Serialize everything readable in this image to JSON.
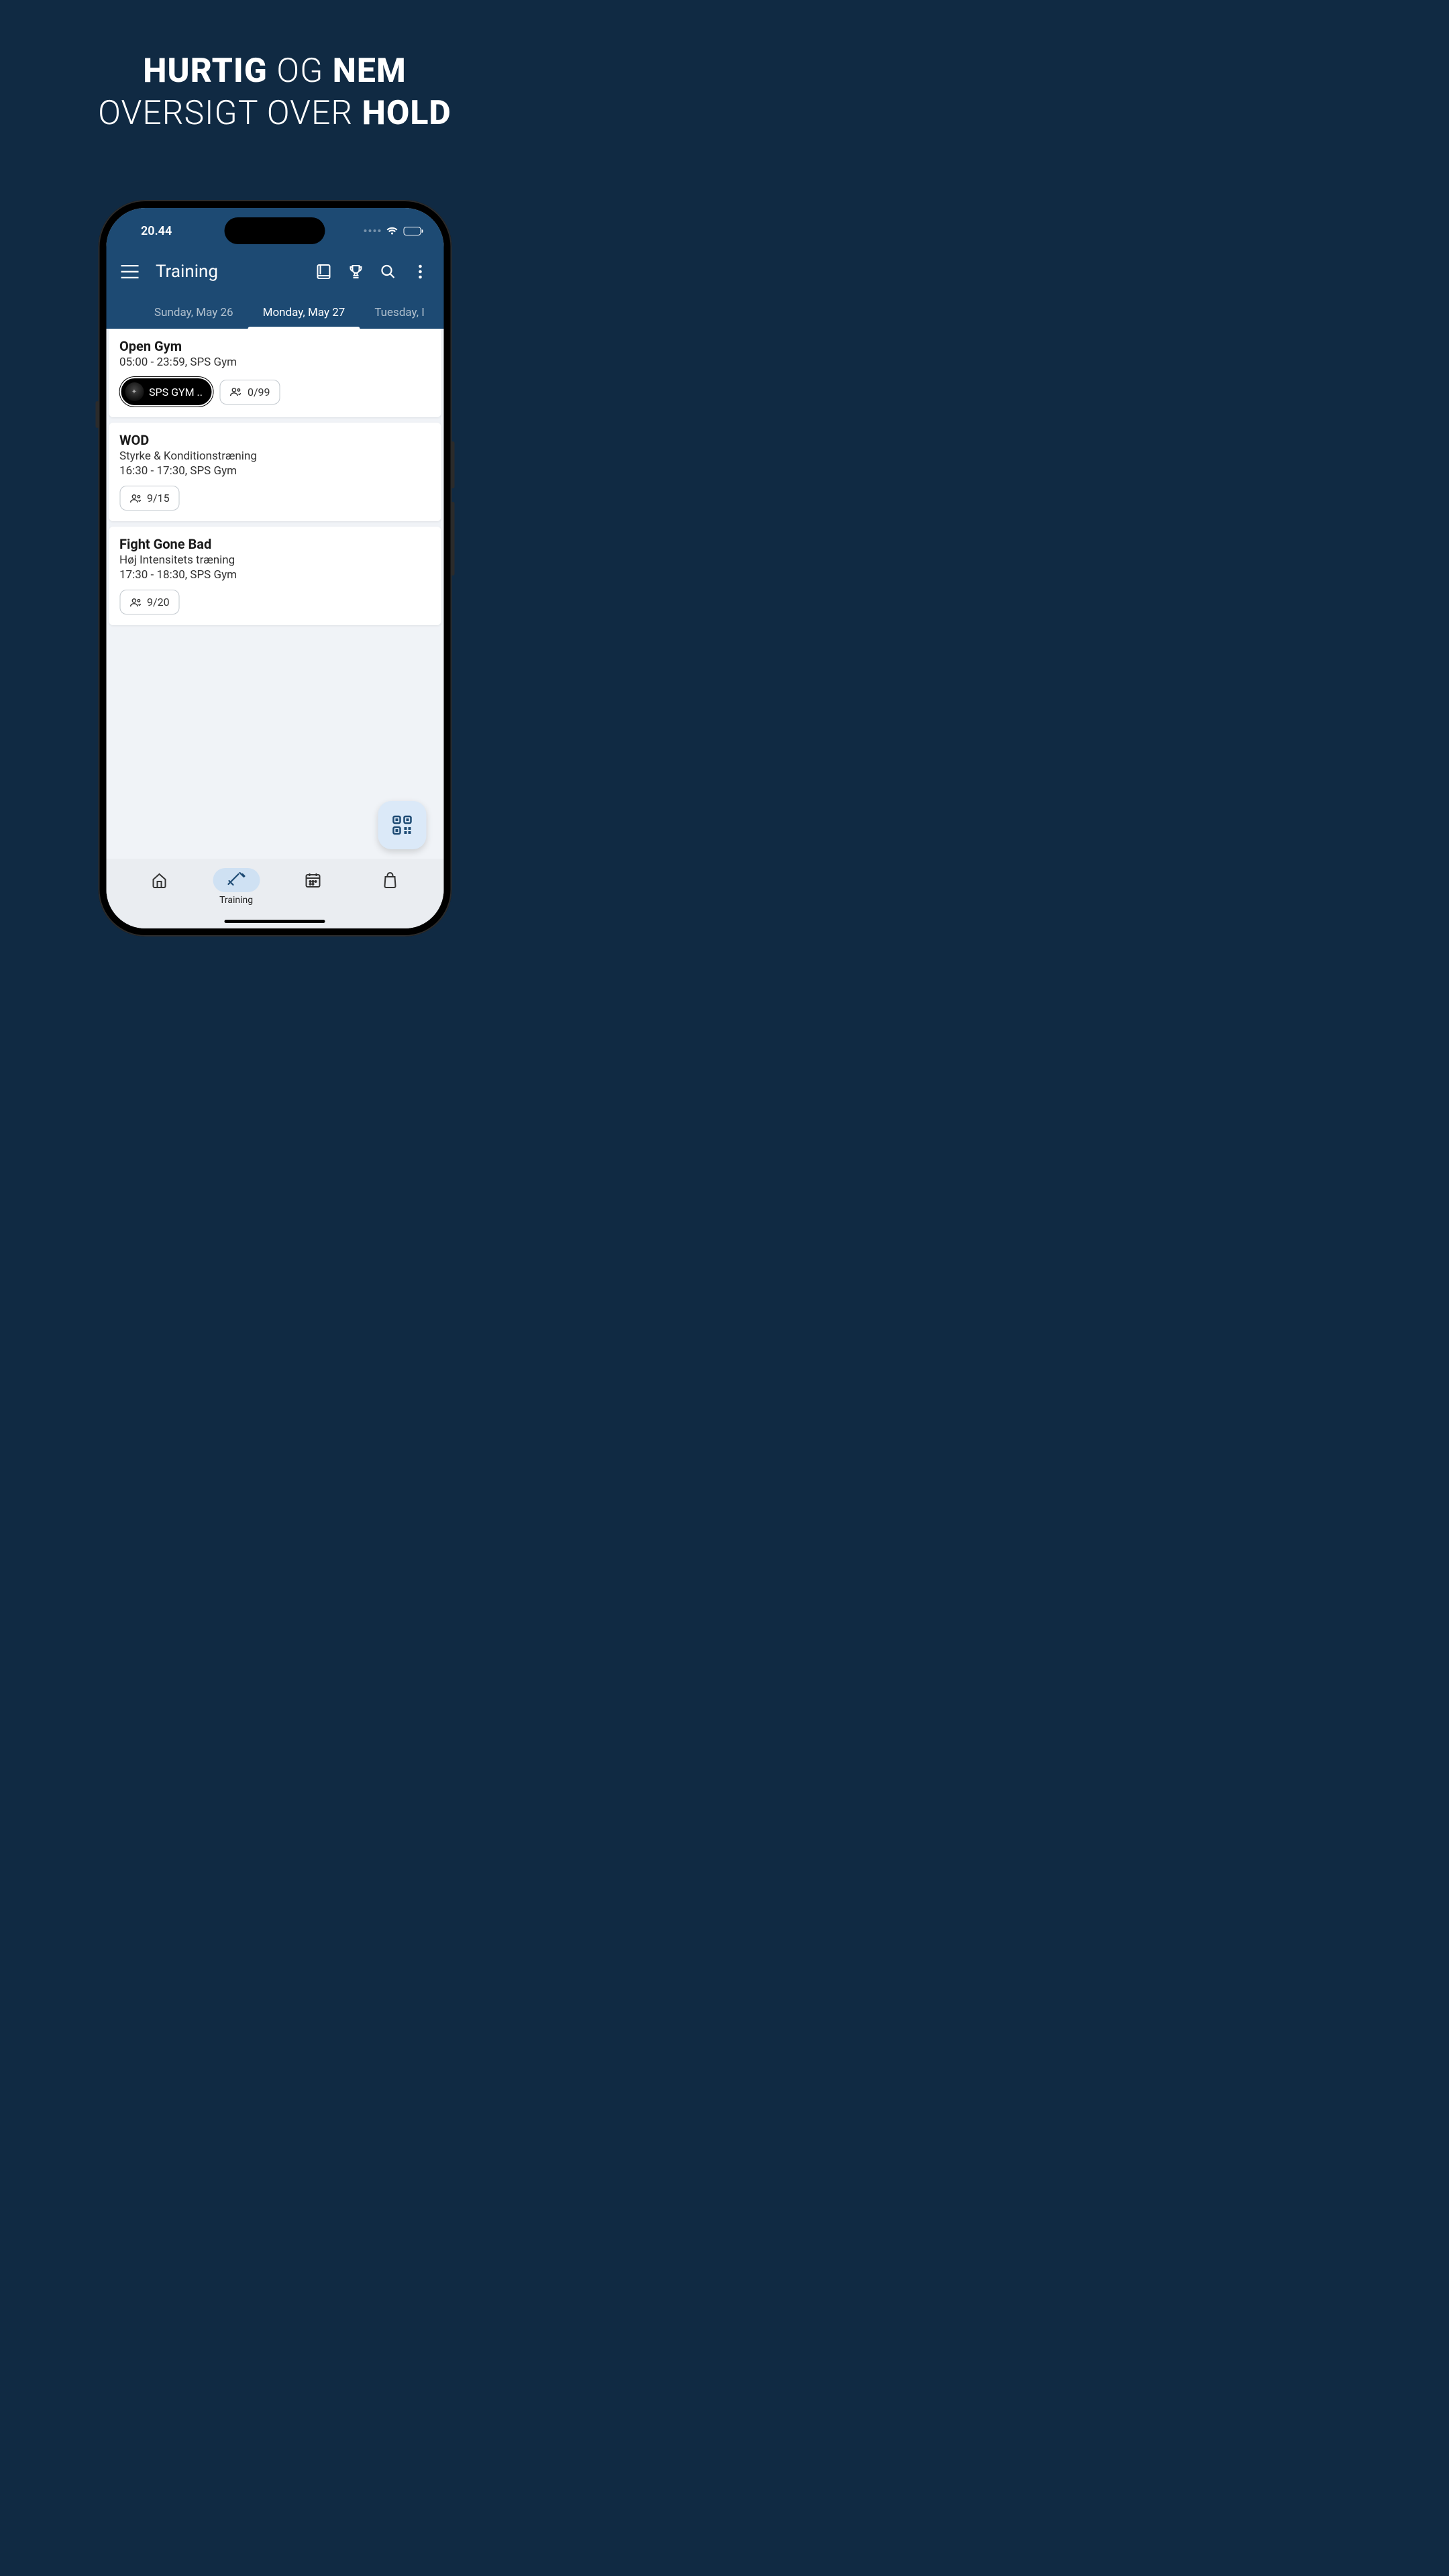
{
  "promo": {
    "w1": "HURTIG",
    "w2": "OG",
    "w3": "NEM",
    "w4": "OVERSIGT OVER",
    "w5": "HOLD"
  },
  "status": {
    "time": "20.44"
  },
  "appbar": {
    "title": "Training"
  },
  "datetabs": {
    "t0": "Sunday, May 26",
    "t1": "Monday, May 27",
    "t2": "Tuesday, I"
  },
  "classes": [
    {
      "title": "Open Gym",
      "sub": "",
      "time": "05:00 - 23:59, SPS Gym",
      "tag": "SPS GYM ..",
      "count": "0/99"
    },
    {
      "title": "WOD",
      "sub": "Styrke & Konditionstræning",
      "time": "16:30 - 17:30, SPS Gym",
      "tag": "",
      "count": "9/15"
    },
    {
      "title": "Fight Gone Bad",
      "sub": "Høj Intensitets træning",
      "time": "17:30 - 18:30, SPS Gym",
      "tag": "",
      "count": "9/20"
    }
  ],
  "bottomnav": {
    "training_label": "Training"
  }
}
